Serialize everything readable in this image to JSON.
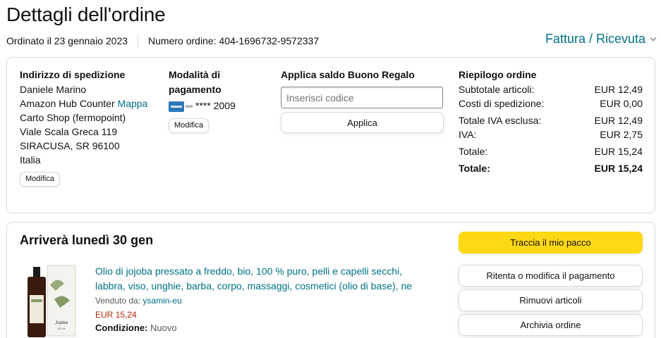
{
  "page": {
    "title": "Dettagli dell'ordine",
    "ordered_on": "Ordinato il 23 gennaio 2023",
    "order_number": "Numero ordine: 404-1696732-9572337",
    "invoice_link": "Fattura / Ricevuta"
  },
  "shipping": {
    "heading": "Indirizzo di spedizione",
    "name": "Daniele Marino",
    "line1_text": "Amazon Hub Counter",
    "map_link": "Mappa",
    "line2": "Carto Shop (fermopoint)",
    "line3": "Viale Scala Greca 119",
    "line4": "SIRACUSA, SR 96100",
    "line5": "Italia",
    "modify_label": "Modifica"
  },
  "payment": {
    "heading_line1": "Modalità di",
    "heading_line2": "pagamento",
    "card_icon": "amex-card-icon",
    "card_masked": "**** 2009",
    "modify_label": "Modifica"
  },
  "gift": {
    "heading": "Applica saldo Buono Regalo",
    "placeholder": "Inserisci codice",
    "apply_label": "Applica"
  },
  "summary": {
    "heading": "Riepilogo ordine",
    "rows": [
      {
        "label": "Subtotale articoli:",
        "value": "EUR 12,49"
      },
      {
        "label": "Costi di spedizione:",
        "value": "EUR 0,00"
      },
      {
        "label": "Totale IVA esclusa:",
        "value": "EUR 12,49"
      },
      {
        "label": "IVA:",
        "value": "EUR 2,75"
      },
      {
        "label": "Totale:",
        "value": "EUR 15,24"
      },
      {
        "label": "Totale:",
        "value": "EUR 15,24"
      }
    ]
  },
  "shipment": {
    "arrival": "Arriverà lunedì 30 gen",
    "track_label": "Traccia il mio pacco",
    "retry_payment_label": "Ritenta o modifica il pagamento",
    "remove_items_label": "Rimuovi articoli",
    "archive_label": "Archivia ordine"
  },
  "product": {
    "title_line1": "Olio di jojoba pressato a freddo, bio, 100 % puro, pelli e capelli secchi,",
    "title_line2": "labbra, viso, unghie, barba, corpo, massaggi, cosmetici (olio di base), ne",
    "sold_by_label": "Venduto da:",
    "seller": "ysamin-eu",
    "price": "EUR 15,24",
    "condition_label": "Condizione:",
    "condition_value": "Nuovo",
    "image_label_top": "Jojoba",
    "image_label_bottom": "100 ml"
  },
  "colors": {
    "link": "#007185",
    "primary_button": "#ffd814",
    "price": "#b12704",
    "border": "#d5d9d9"
  }
}
